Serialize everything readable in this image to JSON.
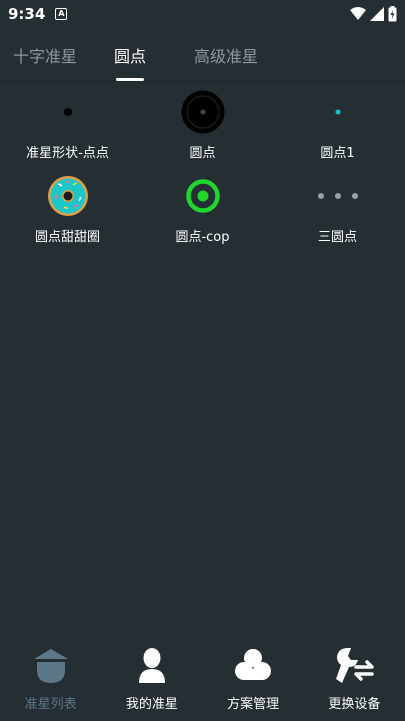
{
  "status_bar": {
    "time": "9:34",
    "notification_icon": "a-box-icon",
    "icons": [
      "wifi-icon",
      "signal-icon",
      "battery-charging-icon"
    ]
  },
  "tabs": [
    {
      "label": "十字准星",
      "active": false
    },
    {
      "label": "圆点",
      "active": true
    },
    {
      "label": "高级准星",
      "active": false
    }
  ],
  "grid": [
    {
      "label": "准星形状-点点",
      "icon": "small-dot-icon"
    },
    {
      "label": "圆点",
      "icon": "black-circle-dot-icon"
    },
    {
      "label": "圆点1",
      "icon": "cyan-dot-icon"
    },
    {
      "label": "圆点甜甜圈",
      "icon": "donut-icon"
    },
    {
      "label": "圆点-cop",
      "icon": "green-ring-dot-icon"
    },
    {
      "label": "三圆点",
      "icon": "three-dots-icon"
    }
  ],
  "bottom_nav": [
    {
      "label": "准星列表",
      "icon": "crosshair-list-icon",
      "active": true
    },
    {
      "label": "我的准星",
      "icon": "user-icon",
      "active": false
    },
    {
      "label": "方案管理",
      "icon": "cloud-icon",
      "active": false
    },
    {
      "label": "更换设备",
      "icon": "wrench-swap-icon",
      "active": false
    }
  ],
  "colors": {
    "background": "#252e33",
    "accent_green": "#1fd62c",
    "accent_cyan": "#14c3c3",
    "active_nav": "#5c7787"
  }
}
